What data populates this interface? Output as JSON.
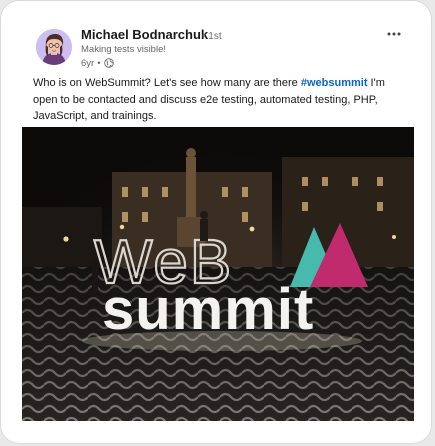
{
  "post": {
    "author": {
      "name": "Michael Bodnarchuk",
      "degree": "1st",
      "headline": "Making tests visible!",
      "age": "6yr",
      "visibility_icon": "globe-icon"
    },
    "more_icon": "ellipsis-icon",
    "text": {
      "before_hashtag": "Who is on WebSummit? Let's see how many are there ",
      "hashtag": "#websummit",
      "after_hashtag": " I'm open to be contacted and discuss e2e testing, automated testing, PHP, JavaScript, and trainings."
    },
    "image": {
      "sign_top": "WeB",
      "sign_bottom": "summit"
    }
  },
  "colors": {
    "hashtag": "#0a66c2",
    "sign_teal": "#47b9ad",
    "sign_magenta": "#c02b6e"
  }
}
